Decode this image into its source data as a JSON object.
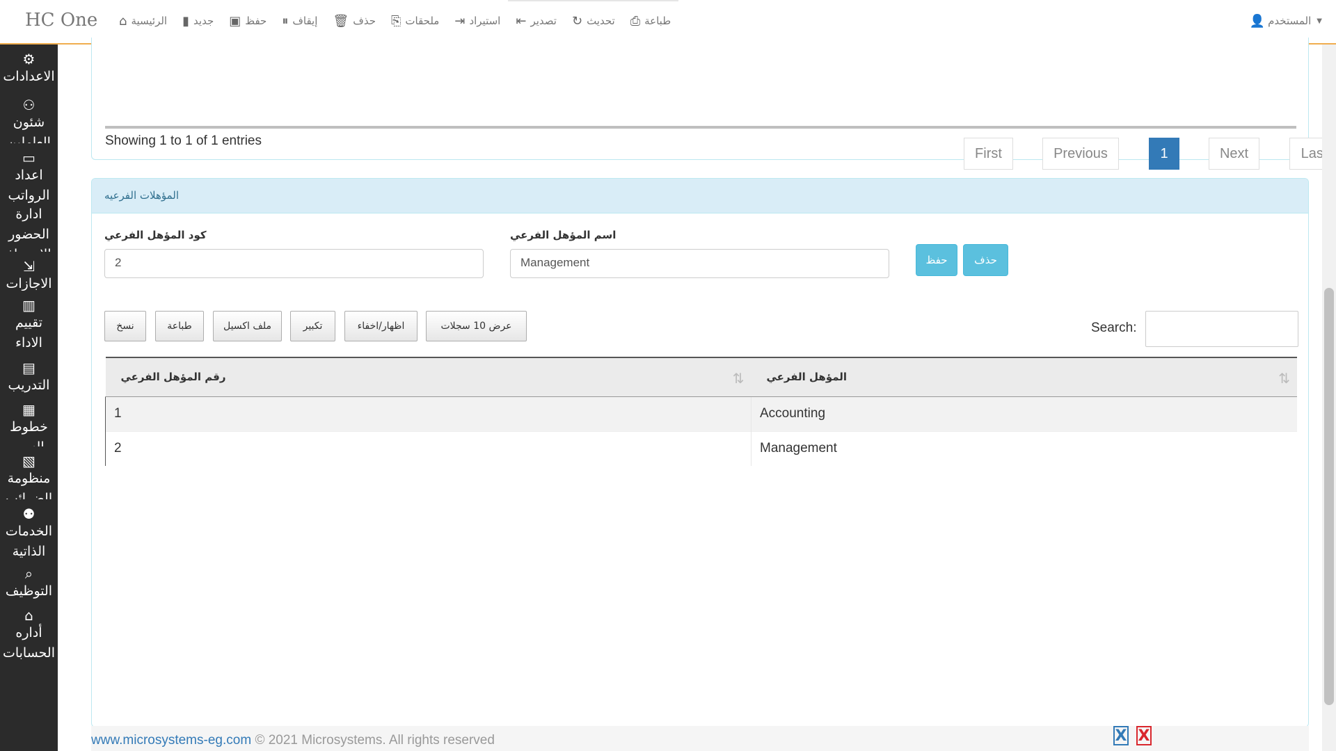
{
  "app": {
    "brand": "HC One"
  },
  "topnav": [
    {
      "label": "الرئيسية",
      "icon": "⌂"
    },
    {
      "label": "جديد",
      "icon": "▮"
    },
    {
      "label": "حفظ",
      "icon": "▣"
    },
    {
      "label": "إيقاف",
      "icon": "⏸"
    },
    {
      "label": "حذف",
      "icon": "🗑"
    },
    {
      "label": "ملحقات",
      "icon": "⎘"
    },
    {
      "label": "استيراد",
      "icon": "⇥"
    },
    {
      "label": "تصدير",
      "icon": "⇤"
    },
    {
      "label": "تحديث",
      "icon": "↻"
    },
    {
      "label": "طباعة",
      "icon": "⎙"
    }
  ],
  "user": {
    "label": "المستخدم",
    "icon": "👤"
  },
  "sidebar": [
    {
      "label": "الاعدادات",
      "icon": "⚙"
    },
    {
      "label": "شئون العاملين",
      "icon": "⚇"
    },
    {
      "label": "اعداد الرواتب",
      "icon": "▭"
    },
    {
      "label": "ادارة الحضور والانصراف",
      "icon": ""
    },
    {
      "label": "الاجازات",
      "icon": "⇲"
    },
    {
      "label": "تقييم الاداء",
      "icon": "▥"
    },
    {
      "label": "التدريب",
      "icon": "▤"
    },
    {
      "label": "خطوط السير",
      "icon": "▦"
    },
    {
      "label": "منظومة الضرائب",
      "icon": "▧"
    },
    {
      "label": "الخدمات الذاتية",
      "icon": "⚉"
    },
    {
      "label": "التوظيف",
      "icon": "⌕"
    },
    {
      "label": "أداره الحسابات",
      "icon": "⌂"
    }
  ],
  "top_table": {
    "info": "Showing 1 to 1 of 1 entries",
    "pager": {
      "first": "First",
      "previous": "Previous",
      "current": "1",
      "next": "Next",
      "last": "Last"
    }
  },
  "sub_qualifications": {
    "heading": "المؤهلات الفرعيه",
    "code_label": "كود المؤهل الفرعي",
    "code_value": "2",
    "name_label": "اسم المؤهل الفرعي",
    "name_value": "Management",
    "save_label": "حفظ",
    "delete_label": "حذف",
    "toolbar": {
      "copy": "نسخ",
      "print": "طباعة",
      "excel": "ملف اكسيل",
      "zoom": "تكبير",
      "toggle": "اظهار/اخفاء",
      "show_rows": "عرض 10 سجلات"
    },
    "search_label": "Search:",
    "columns": {
      "number": "رقم المؤهل الفرعي",
      "name": "المؤهل الفرعي"
    },
    "rows": [
      {
        "number": "1",
        "name": "Accounting"
      },
      {
        "number": "2",
        "name": "Management"
      }
    ]
  },
  "footer": {
    "site": "www.microsystems-eg.com",
    "rights": "© 2021 Microsystems. All rights reserved",
    "badge_blue": "X",
    "badge_red": "X"
  },
  "colors": {
    "accent": "#f0ad4e",
    "sidebar": "#2b2b2b",
    "info": "#5bc0de",
    "primary": "#337ab7"
  }
}
